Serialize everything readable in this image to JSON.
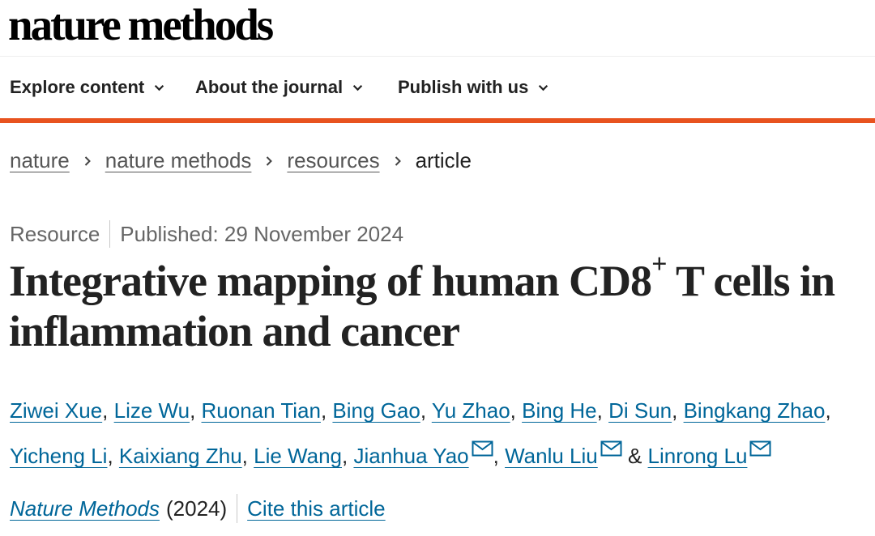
{
  "header": {
    "logo": "nature methods"
  },
  "nav": {
    "items": [
      {
        "label": "Explore content"
      },
      {
        "label": "About the journal"
      },
      {
        "label": "Publish with us"
      }
    ]
  },
  "breadcrumb": {
    "items": [
      "nature",
      "nature methods",
      "resources"
    ],
    "current": "article"
  },
  "article": {
    "type": "Resource",
    "published": "Published: 29 November 2024",
    "title_part1": "Integrative mapping of human CD8",
    "title_sup": "+",
    "title_part2": " T cells in inflammation and cancer",
    "authors": [
      "Ziwei Xue",
      "Lize Wu",
      "Ruonan Tian",
      "Bing Gao",
      "Yu Zhao",
      "Bing He",
      "Di Sun",
      "Bingkang Zhao",
      "Yicheng Li",
      "Kaixiang Zhu",
      "Lie Wang",
      "Jianhua Yao",
      "Wanlu Liu",
      "Linrong Lu"
    ],
    "separator": ", ",
    "ampersand": "&",
    "journal": "Nature Methods",
    "year": "(2024)",
    "cite_label": "Cite this article"
  },
  "colors": {
    "accent": "#e8531f",
    "link": "#006699",
    "text": "#222222",
    "muted": "#666666"
  },
  "icons": {
    "nav_chevron": "chevron-down-icon",
    "breadcrumb_sep": "chevron-right-icon",
    "email": "email-icon"
  }
}
